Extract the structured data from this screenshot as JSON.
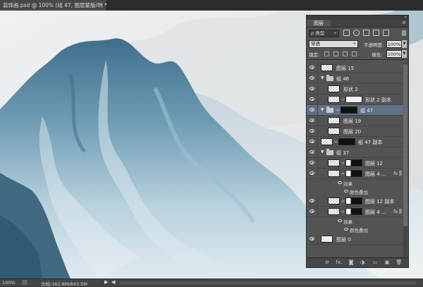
{
  "document": {
    "tab_title": "装饰画.psd @ 100% (组 47, 图层蒙版/8) *",
    "tab_close": "×"
  },
  "status": {
    "zoom": "100%",
    "doc_info": "文档:162.8M/843.5M",
    "arrow": "▶",
    "scroll_left": "◀"
  },
  "panel": {
    "tab_label": "图层",
    "collapse_glyph": "»",
    "menu_glyph": "≡",
    "filter": {
      "kind_label": "ρ 类型",
      "caret": "÷",
      "icons": [
        "image-filter-icon",
        "adjustment-filter-icon",
        "text-filter-icon",
        "shape-filter-icon",
        "smart-object-filter-icon"
      ]
    },
    "blend": {
      "mode": "穿透",
      "caret": "÷",
      "opacity_label": "不透明度:",
      "opacity_value": "100%",
      "drop": "▼"
    },
    "lock": {
      "label": "锁定:",
      "fill_label": "填充:",
      "fill_value": "100%",
      "drop": "▼"
    },
    "layers": [
      {
        "type": "layer",
        "name": "图层 15",
        "indent": 0,
        "thumb": "checker"
      },
      {
        "type": "group",
        "name": "组 46",
        "indent": 0,
        "expanded": true
      },
      {
        "type": "layer",
        "name": "形状 2",
        "indent": 1,
        "thumb": "checker"
      },
      {
        "type": "layer",
        "name": "形状 2 副本",
        "indent": 1,
        "thumb": "checker",
        "mask": "white"
      },
      {
        "type": "group",
        "name": "组 47",
        "indent": 0,
        "expanded": true,
        "selected": true,
        "mask": "black"
      },
      {
        "type": "layer",
        "name": "图层 19",
        "indent": 1,
        "thumb": "checker"
      },
      {
        "type": "layer",
        "name": "图层 20",
        "indent": 1,
        "thumb": "checker"
      },
      {
        "type": "layer",
        "name": "组 47 副本",
        "indent": 0,
        "thumb": "checker",
        "mask": "black"
      },
      {
        "type": "group",
        "name": "组 37",
        "indent": 0,
        "expanded": true
      },
      {
        "type": "layer",
        "name": "图层 12",
        "indent": 1,
        "thumb": "checker",
        "mask": "mixed"
      },
      {
        "type": "layer",
        "name": "图层 4 ...",
        "indent": 1,
        "thumb": "checker",
        "mask": "mixed",
        "fx": "fx"
      },
      {
        "type": "effect",
        "name": "效果"
      },
      {
        "type": "effect-item",
        "name": "颜色叠加"
      },
      {
        "type": "layer",
        "name": "图层 12 副本",
        "indent": 1,
        "thumb": "checker",
        "mask": "mixed"
      },
      {
        "type": "layer",
        "name": "图层 4 ...",
        "indent": 1,
        "thumb": "checker",
        "mask": "mixed",
        "fx": "fx"
      },
      {
        "type": "effect",
        "name": "效果"
      },
      {
        "type": "effect-item",
        "name": "颜色叠加"
      },
      {
        "type": "layer",
        "name": "图层 0",
        "indent": 0,
        "thumb": "plain"
      }
    ],
    "footer_buttons": [
      {
        "name": "link-layers-icon",
        "glyph": "⊖"
      },
      {
        "name": "layer-style-icon",
        "glyph": "fx."
      },
      {
        "name": "add-mask-icon",
        "glyph": "◙"
      },
      {
        "name": "adjustment-layer-icon",
        "glyph": "◑."
      },
      {
        "name": "new-group-icon",
        "glyph": "▭"
      },
      {
        "name": "new-layer-icon",
        "glyph": "▣"
      },
      {
        "name": "delete-layer-icon",
        "glyph": "🗑"
      }
    ]
  },
  "colors": {
    "selected_row": "#5f7088",
    "panel_bg": "#535353",
    "mountain_blue": "#5e8ea8",
    "sky": "#e7e9eb"
  }
}
